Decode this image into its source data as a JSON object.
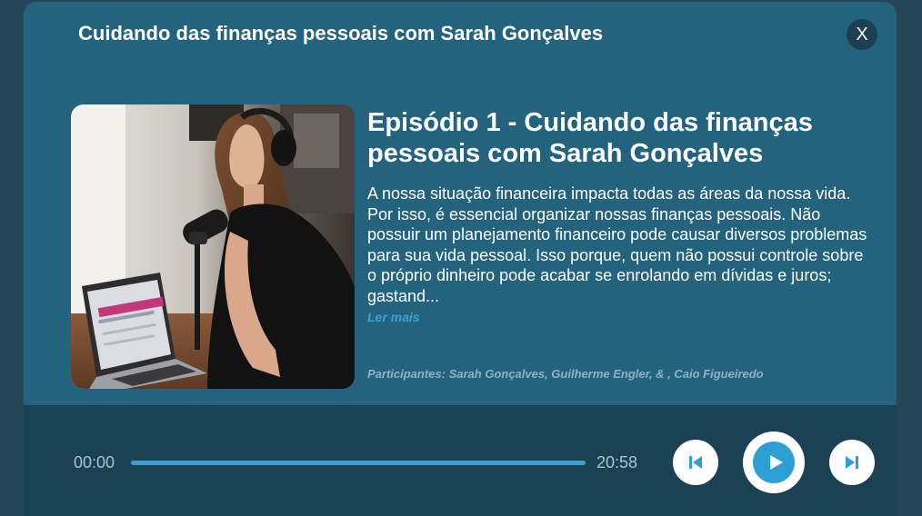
{
  "modal": {
    "title": "Cuidando das finanças pessoais com Sarah Gonçalves",
    "close_label": "X"
  },
  "episode": {
    "title": "Episódio 1 - Cuidando das finanças pessoais com Sarah Gonçalves",
    "description": "A nossa situação financeira impacta todas as áreas da nossa vida. Por isso, é essencial organizar nossas finanças pessoais. Não possuir um planejamento financeiro pode causar diversos problemas para sua vida pessoal. Isso porque, quem não possui controle sobre o próprio dinheiro pode acabar se enrolando em dívidas e juros; gastand...",
    "read_more_label": "Ler mais",
    "participants": "Participantes: Sarah Gonçalves, Guilherme Engler, & , Caio Figueiredo"
  },
  "player": {
    "current_time": "00:00",
    "total_time": "20:58",
    "progress_fraction": 0,
    "prev_icon": "skip-previous-icon",
    "play_icon": "play-icon",
    "next_icon": "skip-next-icon"
  },
  "colors": {
    "background": "#244656",
    "modal": "#24637d",
    "player_bar": "#1b4254",
    "accent": "#2e9fd5",
    "link": "#3aa3d6"
  }
}
